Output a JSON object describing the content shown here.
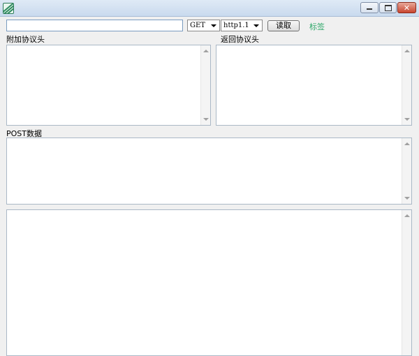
{
  "window": {
    "minimize_symbol": "",
    "maximize_symbol": "",
    "close_symbol": "✕"
  },
  "toolbar": {
    "url_value": "",
    "url_placeholder": "",
    "method_selected": "GET",
    "version_selected": "http1.1",
    "read_label": "读取",
    "tag_label": "标签"
  },
  "labels": {
    "extra_headers": "附加协议头",
    "response_headers": "返回协议头",
    "post_data": "POST数据"
  },
  "icons": {
    "app": "app-icon",
    "minimize": "minimize-icon",
    "maximize": "maximize-icon",
    "close": "close-icon",
    "dropdown": "chevron-down-icon"
  },
  "colors": {
    "tag_link": "#2fa86a",
    "titlebar": "#d4e2f2"
  }
}
